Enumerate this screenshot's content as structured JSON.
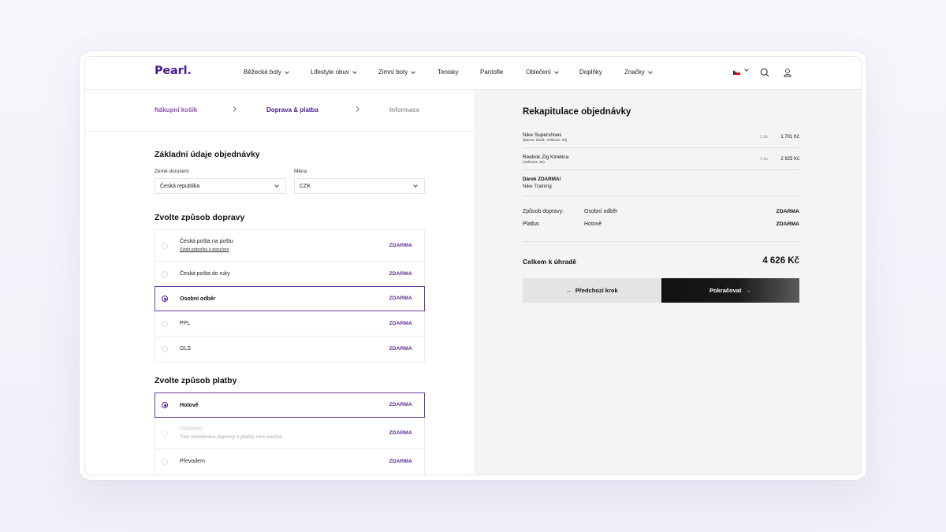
{
  "brand": {
    "logo": "Pearl.",
    "accent": "#4b1c8f"
  },
  "nav": {
    "items": [
      {
        "label": "Běžecké boty",
        "has_dropdown": true
      },
      {
        "label": "Lifestyle obuv",
        "has_dropdown": true
      },
      {
        "label": "Zimní boty",
        "has_dropdown": true
      },
      {
        "label": "Tenisky",
        "has_dropdown": false
      },
      {
        "label": "Pantofle",
        "has_dropdown": false
      },
      {
        "label": "Oblečení",
        "has_dropdown": true
      },
      {
        "label": "Doplňky",
        "has_dropdown": false
      },
      {
        "label": "Značky",
        "has_dropdown": true
      }
    ],
    "language_flag": "cz-flag-icon"
  },
  "steps": [
    {
      "label": "Nákupní košík",
      "state": "done"
    },
    {
      "label": "Doprava & platba",
      "state": "active"
    },
    {
      "label": "Informace",
      "state": "todo"
    }
  ],
  "basic": {
    "title": "Základní údaje objednávky",
    "country_label": "Země doručení",
    "country_value": "Česká republika",
    "currency_label": "Měna",
    "currency_value": "CZK"
  },
  "shipping": {
    "title": "Zvolte způsob dopravy",
    "options": [
      {
        "label": "Česká pošta na poštu",
        "sub": "Zvolit pobočku k doručení",
        "price": "ZDARMA",
        "selected": false
      },
      {
        "label": "Česká pošta do ruky",
        "price": "ZDARMA",
        "selected": false
      },
      {
        "label": "Osobní odběr",
        "price": "ZDARMA",
        "selected": true
      },
      {
        "label": "PPL",
        "price": "ZDARMA",
        "selected": false
      },
      {
        "label": "GLS",
        "price": "ZDARMA",
        "selected": false
      }
    ]
  },
  "payment": {
    "title": "Zvolte způsob platby",
    "options": [
      {
        "label": "Hotově",
        "price": "ZDARMA",
        "selected": true
      },
      {
        "label": "Dobírkou",
        "note": "Tato kombinace dopravy a platby není možná.",
        "price": "ZDARMA",
        "disabled": true
      },
      {
        "label": "Převodem",
        "price": "ZDARMA",
        "selected": false
      }
    ]
  },
  "summary": {
    "title": "Rekapitulace objednávky",
    "items": [
      {
        "name": "Nike Supershoes",
        "meta": "(Barva: Žlutá, Velikost: 39)",
        "qty": "1 ks",
        "price": "1 701 Kč"
      },
      {
        "name": "Reebok Zig Kinetica",
        "meta": "(Velikost: 39)",
        "qty": "1 ks",
        "price": "2 925 Kč"
      }
    ],
    "gift_title": "Dárek ZDARMA!",
    "gift_name": "Nike Training",
    "shipping_key": "Způsob dopravy:",
    "shipping_val": "Osobní odběr",
    "shipping_price": "ZDARMA",
    "payment_key": "Platba:",
    "payment_val": "Hotově",
    "payment_price": "ZDARMA",
    "total_label": "Celkem k úhradě",
    "total_value": "4 626 Kč",
    "prev_button": "Předchozí krok",
    "next_button": "Pokračovat"
  }
}
